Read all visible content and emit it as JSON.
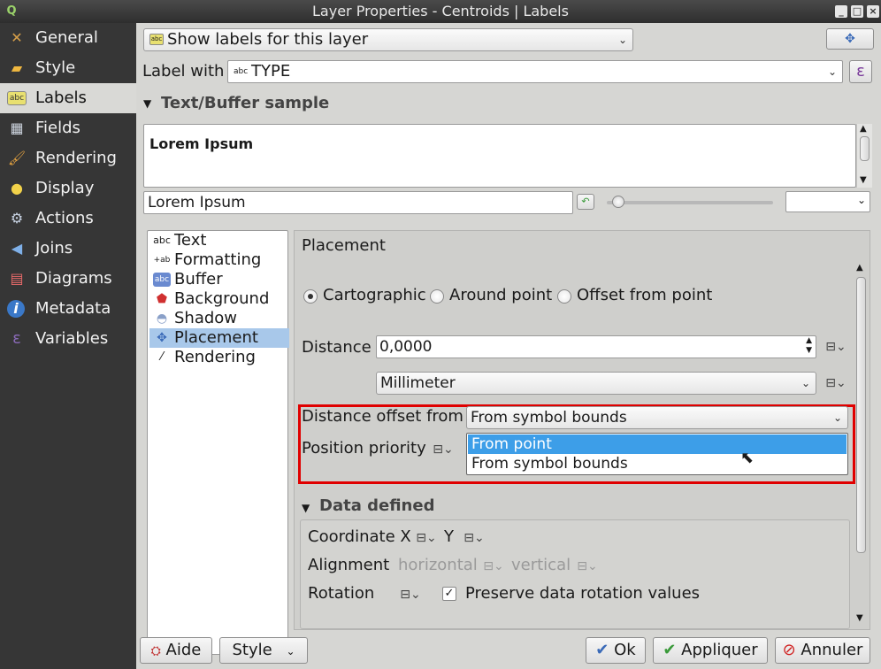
{
  "window": {
    "title": "Layer Properties - Centroids | Labels",
    "app_icon": "qgis-icon"
  },
  "nav": {
    "items": [
      {
        "label": "General",
        "icon": "tools-icon"
      },
      {
        "label": "Style",
        "icon": "style-icon"
      },
      {
        "label": "Labels",
        "icon": "labels-icon"
      },
      {
        "label": "Fields",
        "icon": "fields-icon"
      },
      {
        "label": "Rendering",
        "icon": "brush-icon"
      },
      {
        "label": "Display",
        "icon": "speech-bubble-icon"
      },
      {
        "label": "Actions",
        "icon": "gear-icon"
      },
      {
        "label": "Joins",
        "icon": "joins-icon"
      },
      {
        "label": "Diagrams",
        "icon": "diagram-icon"
      },
      {
        "label": "Metadata",
        "icon": "info-icon"
      },
      {
        "label": "Variables",
        "icon": "variables-icon"
      }
    ],
    "selected": "Labels"
  },
  "top": {
    "mode_combo": "Show labels for this layer",
    "label_with_label": "Label with",
    "label_with_value": "TYPE",
    "abc_tag": "abc",
    "expression_symbol": "ε",
    "sample_header": "Text/Buffer sample",
    "sample_text": "Lorem Ipsum",
    "sample_input": "Lorem Ipsum"
  },
  "sidelist": {
    "items": [
      {
        "label": "Text",
        "icon": "abc"
      },
      {
        "label": "Formatting",
        "icon": "+ab"
      },
      {
        "label": "Buffer",
        "icon": "abc"
      },
      {
        "label": "Background",
        "icon": "shield"
      },
      {
        "label": "Shadow",
        "icon": "shadow"
      },
      {
        "label": "Placement",
        "icon": "placement"
      },
      {
        "label": "Rendering",
        "icon": "brush"
      }
    ],
    "selected": "Placement"
  },
  "placement": {
    "title": "Placement",
    "radios": [
      "Cartographic",
      "Around point",
      "Offset from point"
    ],
    "radio_selected": "Cartographic",
    "distance_label": "Distance",
    "distance_value": "0,0000",
    "unit_value": "Millimeter",
    "offset_from_label": "Distance offset from",
    "offset_from_value": "From symbol bounds",
    "position_priority_label": "Position priority",
    "dropdown_options": [
      "From point",
      "From symbol bounds"
    ],
    "dropdown_highlighted": "From point",
    "highlight_color": "#e00000",
    "selection_color": "#3d9ee8"
  },
  "data_defined": {
    "header": "Data defined",
    "coordinate_label": "Coordinate X",
    "y_label": "Y",
    "alignment_label": "Alignment",
    "horizontal_label": "horizontal",
    "vertical_label": "vertical",
    "rotation_label": "Rotation",
    "preserve_label": "Preserve data rotation values",
    "preserve_checked": true
  },
  "bottom": {
    "help": "Aide",
    "style": "Style",
    "ok": "Ok",
    "apply": "Appliquer",
    "cancel": "Annuler"
  }
}
